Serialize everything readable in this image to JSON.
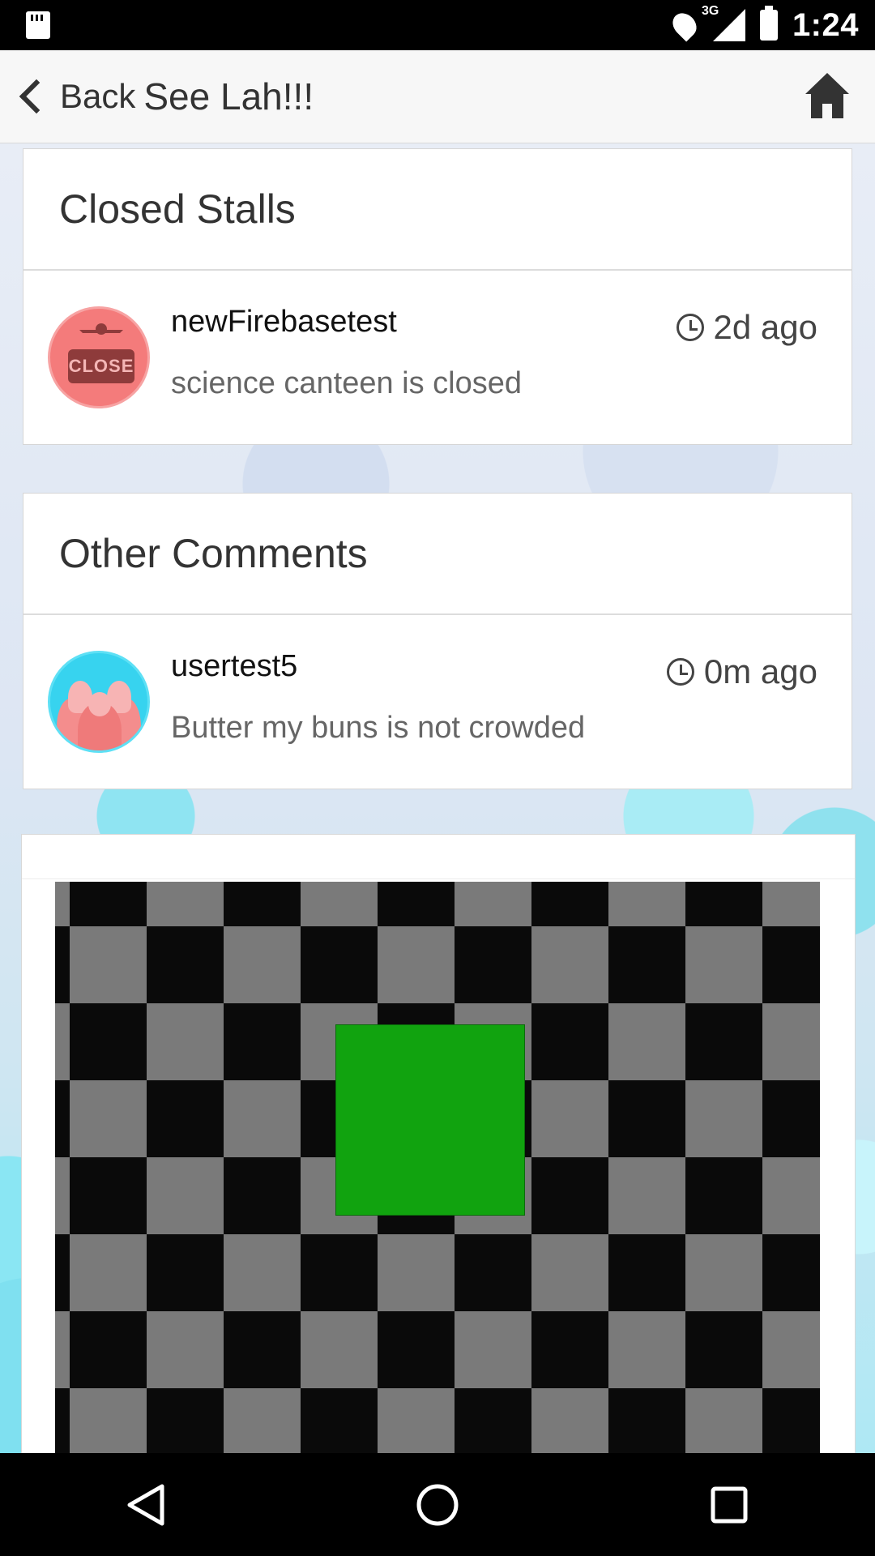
{
  "status_bar": {
    "time": "1:24",
    "network": "3G"
  },
  "app_bar": {
    "back_label": "Back",
    "title": "See Lah!!!"
  },
  "closed_stalls": {
    "heading": "Closed Stalls",
    "items": [
      {
        "user": "newFirebasetest",
        "message": "science canteen is closed",
        "time": "2d ago",
        "badge": "CLOSE"
      }
    ]
  },
  "other_comments": {
    "heading": "Other Comments",
    "items": [
      {
        "user": "usertest5",
        "message": "Butter my buns is not crowded",
        "time": "0m ago"
      }
    ]
  },
  "colors": {
    "close_avatar": "#f47b7b",
    "user_avatar": "#37d3ef",
    "green_block": "#11a30f"
  },
  "icons": [
    "sd-card-icon",
    "location-icon",
    "signal-icon",
    "battery-icon",
    "chevron-left-icon",
    "home-icon",
    "clock-icon",
    "back-triangle-icon",
    "home-circle-icon",
    "recents-square-icon"
  ]
}
